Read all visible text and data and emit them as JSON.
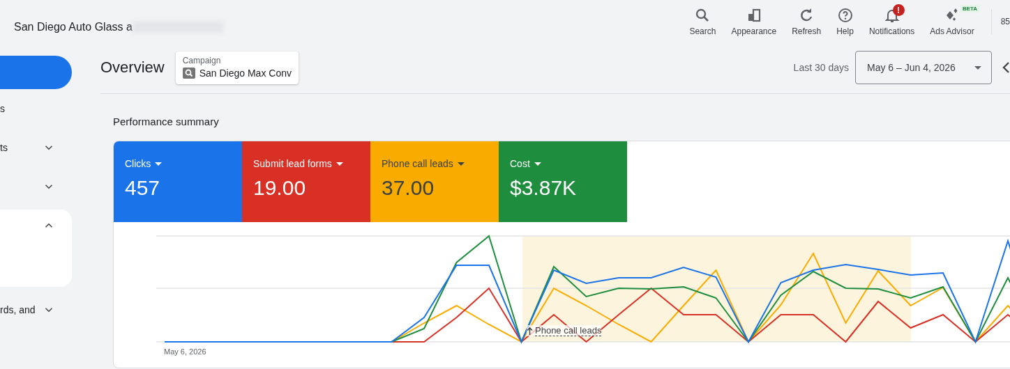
{
  "header": {
    "account_name": "San Diego Auto Glass a",
    "toolbar": [
      {
        "kind": "search",
        "label": "Search"
      },
      {
        "kind": "appearance",
        "label": "Appearance"
      },
      {
        "kind": "refresh",
        "label": "Refresh"
      },
      {
        "kind": "help",
        "label": "Help"
      },
      {
        "kind": "notifications",
        "label": "Notifications",
        "alert": "!"
      },
      {
        "kind": "advisor",
        "label": "Ads Advisor",
        "badge": "BETA"
      }
    ],
    "account_fragment": "85"
  },
  "sidebar": {
    "items": [
      {
        "kind": "pill"
      },
      {
        "kind": "text",
        "label": "s"
      },
      {
        "kind": "group",
        "label": "ts",
        "expanded": false
      },
      {
        "kind": "group",
        "expanded": false
      },
      {
        "kind": "card",
        "expanded": true
      },
      {
        "kind": "group",
        "label": "rds, and",
        "expanded": false
      }
    ]
  },
  "page": {
    "title": "Overview",
    "campaign": {
      "label": "Campaign",
      "value": "San Diego Max Conv"
    },
    "date_range": {
      "label": "Last 30 days",
      "value": "May 6 – Jun 4, 2026"
    }
  },
  "summary": {
    "title": "Performance summary",
    "metrics": [
      {
        "label": "Clicks",
        "value": "457",
        "color": "#1a73e8"
      },
      {
        "label": "Submit lead forms",
        "value": "19.00",
        "color": "#d93025"
      },
      {
        "label": "Phone call leads",
        "value": "37.00",
        "color": "#f9ab00"
      },
      {
        "label": "Cost",
        "value": "$3.87K",
        "color": "#1e8e3e"
      }
    ],
    "chart": {
      "x_label": "May 6, 2026",
      "annotation": "Phone call leads"
    }
  }
}
